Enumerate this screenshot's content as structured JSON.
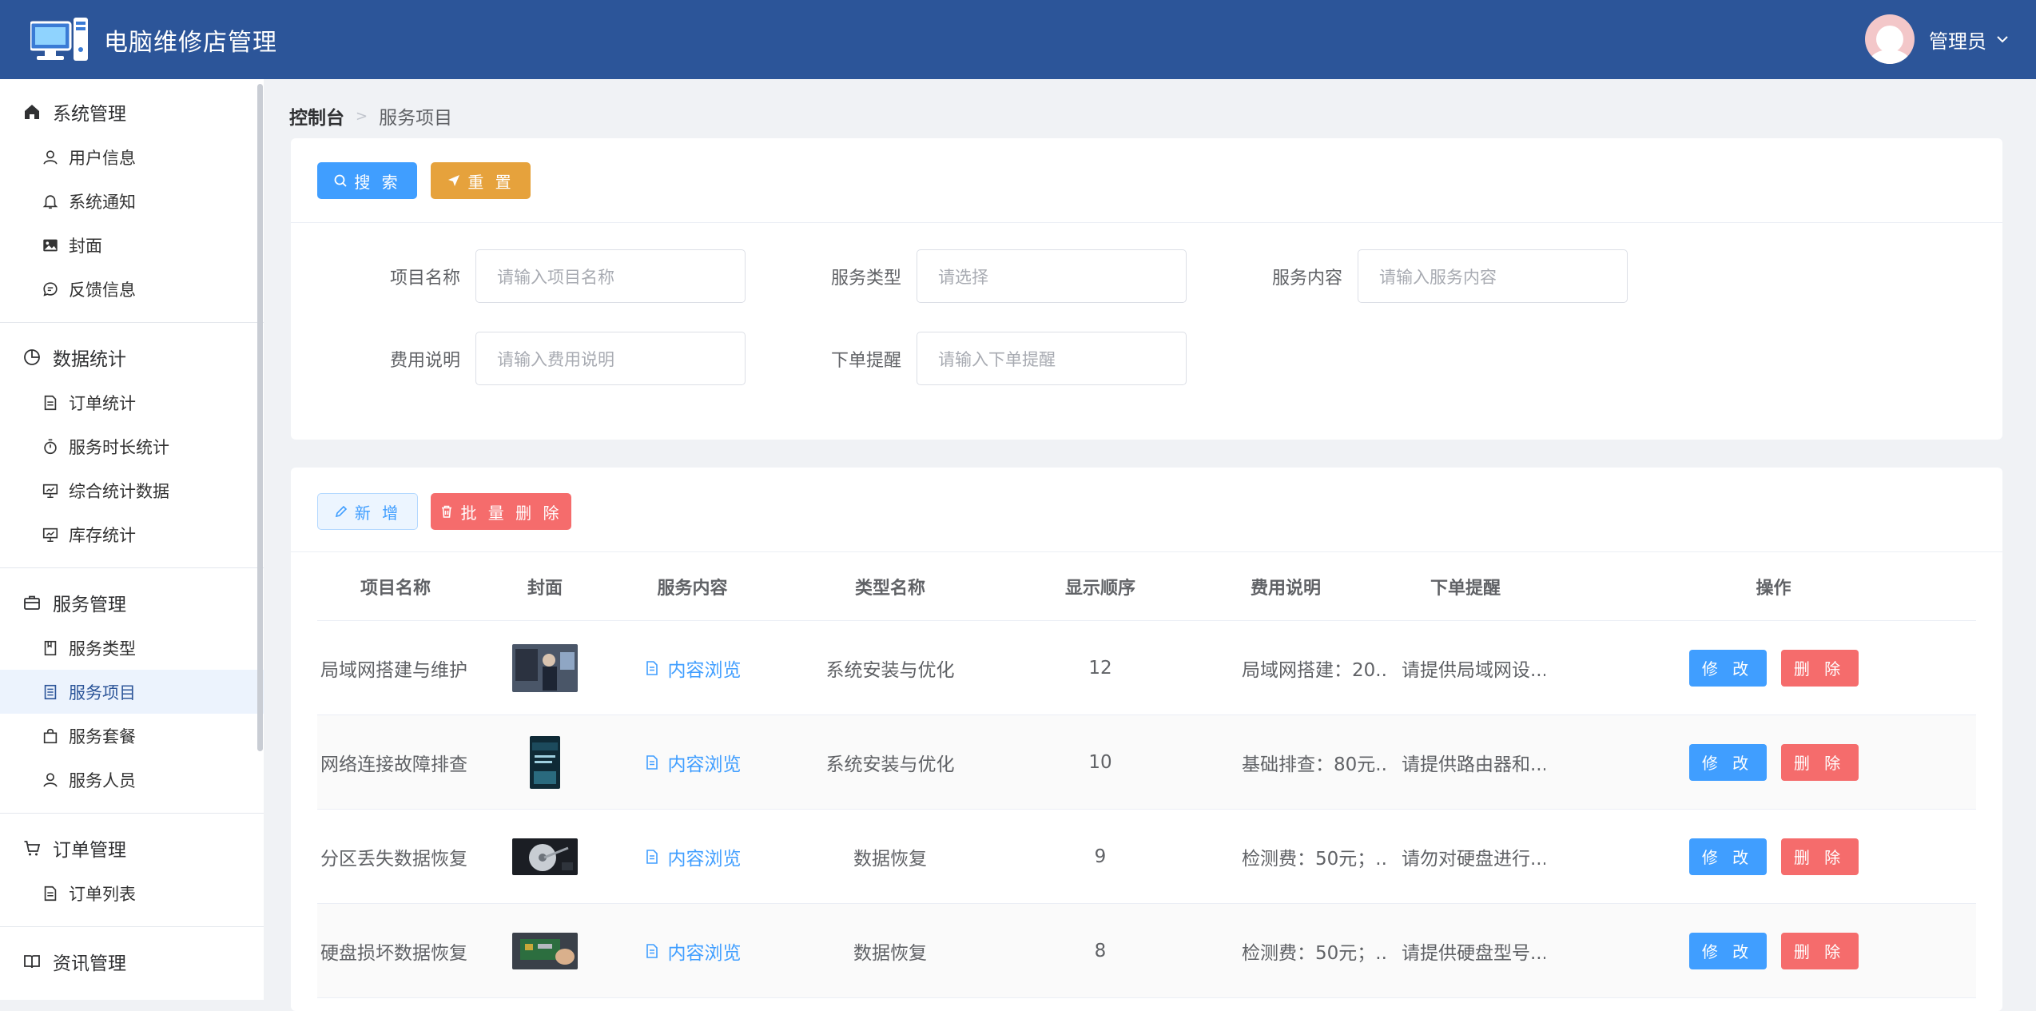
{
  "header": {
    "title": "电脑维修店管理",
    "user_name": "管理员"
  },
  "sidebar": {
    "groups": [
      {
        "title": "系统管理",
        "items": [
          "用户信息",
          "系统通知",
          "封面",
          "反馈信息"
        ]
      },
      {
        "title": "数据统计",
        "items": [
          "订单统计",
          "服务时长统计",
          "综合统计数据",
          "库存统计"
        ]
      },
      {
        "title": "服务管理",
        "items": [
          "服务类型",
          "服务项目",
          "服务套餐",
          "服务人员"
        ]
      },
      {
        "title": "订单管理",
        "items": [
          "订单列表"
        ]
      },
      {
        "title": "资讯管理",
        "items": []
      }
    ],
    "active_item": "服务项目"
  },
  "breadcrumb": {
    "root": "控制台",
    "current": "服务项目"
  },
  "search_panel": {
    "search_label": "搜 索",
    "reset_label": "重 置",
    "fields": {
      "name_label": "项目名称",
      "name_placeholder": "请输入项目名称",
      "type_label": "服务类型",
      "type_placeholder": "请选择",
      "content_label": "服务内容",
      "content_placeholder": "请输入服务内容",
      "fee_label": "费用说明",
      "fee_placeholder": "请输入费用说明",
      "remind_label": "下单提醒",
      "remind_placeholder": "请输入下单提醒"
    }
  },
  "toolbar": {
    "add_label": "新 增",
    "bulk_delete_label": "批 量 删 除"
  },
  "table": {
    "columns": [
      "项目名称",
      "封面",
      "服务内容",
      "类型名称",
      "显示顺序",
      "费用说明",
      "下单提醒",
      "操作"
    ],
    "rows": [
      {
        "name": "局域网搭建与维护",
        "content": "内容浏览",
        "type": "系统安装与优化",
        "order": "12",
        "fee": "局域网搭建：20...",
        "remind": "请提供局域网设..."
      },
      {
        "name": "网络连接故障排查",
        "content": "内容浏览",
        "type": "系统安装与优化",
        "order": "10",
        "fee": "基础排查：80元...",
        "remind": "请提供路由器和..."
      },
      {
        "name": "分区丢失数据恢复",
        "content": "内容浏览",
        "type": "数据恢复",
        "order": "9",
        "fee": "检测费：50元；...",
        "remind": "请勿对硬盘进行..."
      },
      {
        "name": "硬盘损坏数据恢复",
        "content": "内容浏览",
        "type": "数据恢复",
        "order": "8",
        "fee": "检测费：50元；...",
        "remind": "请提供硬盘型号..."
      }
    ],
    "edit_label": "修 改",
    "delete_label": "删 除"
  }
}
